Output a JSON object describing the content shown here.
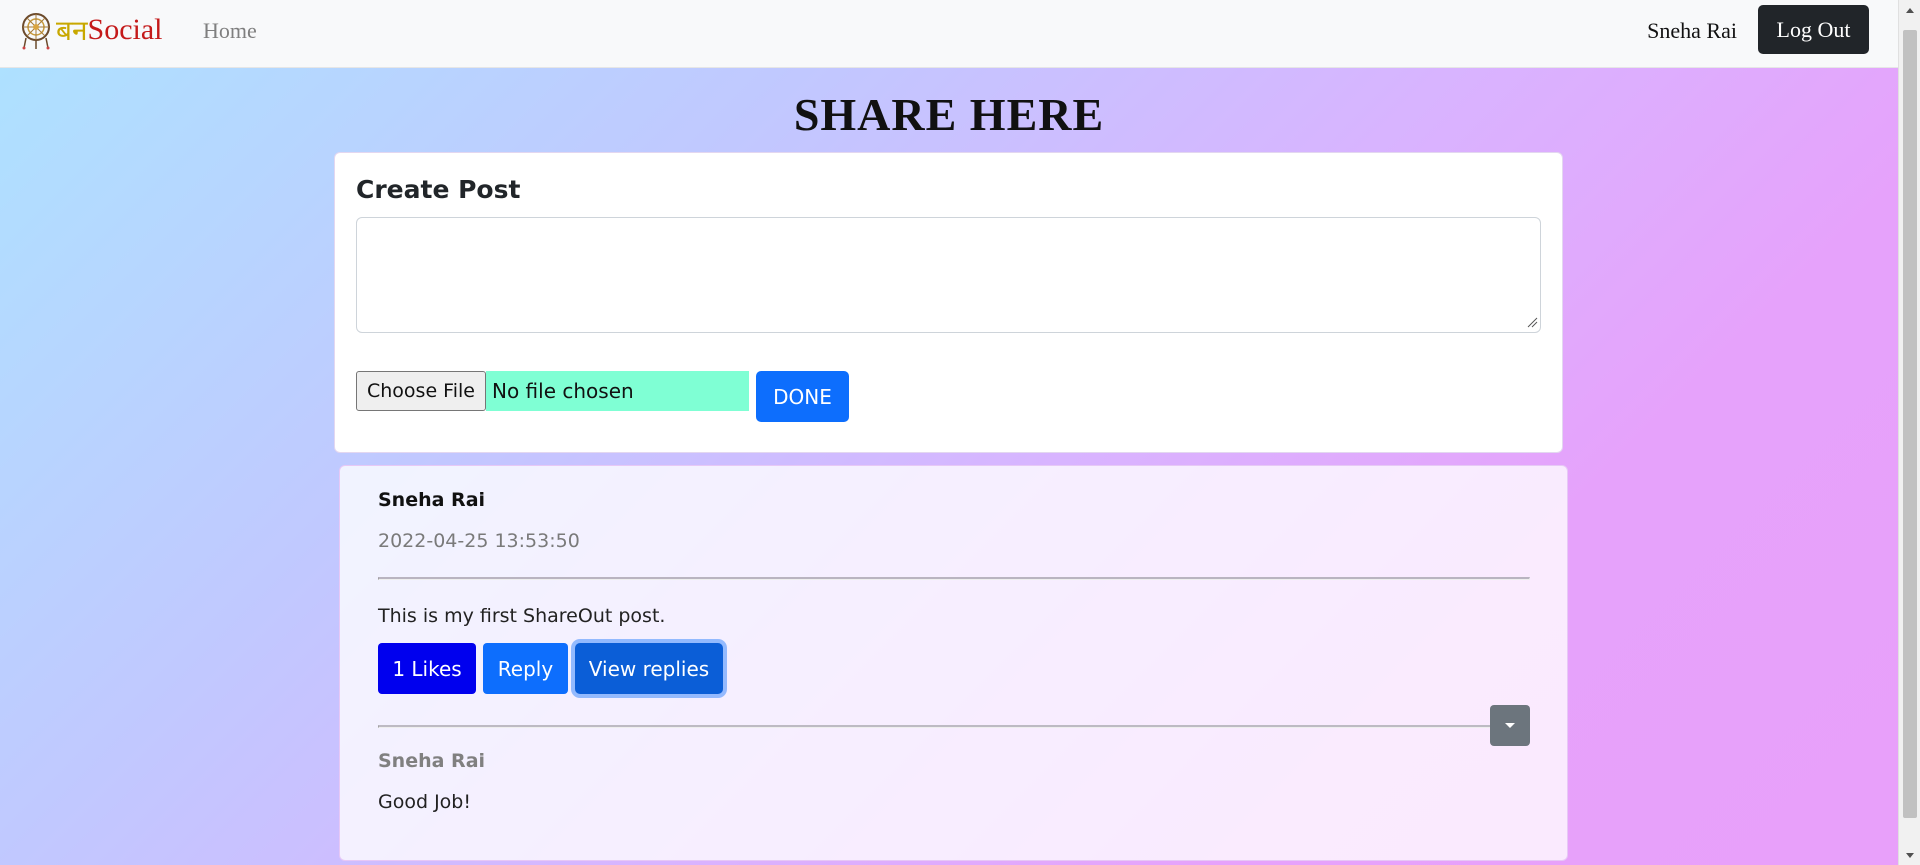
{
  "navbar": {
    "brand_prefix": "बन",
    "brand_name": "Social",
    "home_link": "Home",
    "user_name": "Sneha Rai",
    "logout_label": "Log Out"
  },
  "page": {
    "title": "SHARE HERE"
  },
  "create_post": {
    "heading": "Create Post",
    "textarea_value": "",
    "choose_file_label": "Choose File",
    "file_status": "No file chosen",
    "done_label": "DONE"
  },
  "post": {
    "author": "Sneha Rai",
    "timestamp": "2022-04-25 13:53:50",
    "body": "This is my first ShareOut post.",
    "likes_label": "1 Likes",
    "reply_label": "Reply",
    "view_replies_label": "View replies",
    "replies": [
      {
        "author": "Sneha Rai",
        "body": "Good Job!"
      }
    ]
  },
  "colors": {
    "brand_prefix": "#c8a800",
    "brand_name": "#c41a1a",
    "primary": "#0d6efd",
    "likes": "#0000ee",
    "file_status_bg": "#7fffd4",
    "logout_bg": "#212529"
  },
  "icons": {
    "logo": "dreamcatcher-logo-icon",
    "toggle": "caret-down-icon",
    "scroll_up": "scroll-up-arrow-icon",
    "scroll_down": "scroll-down-arrow-icon"
  }
}
